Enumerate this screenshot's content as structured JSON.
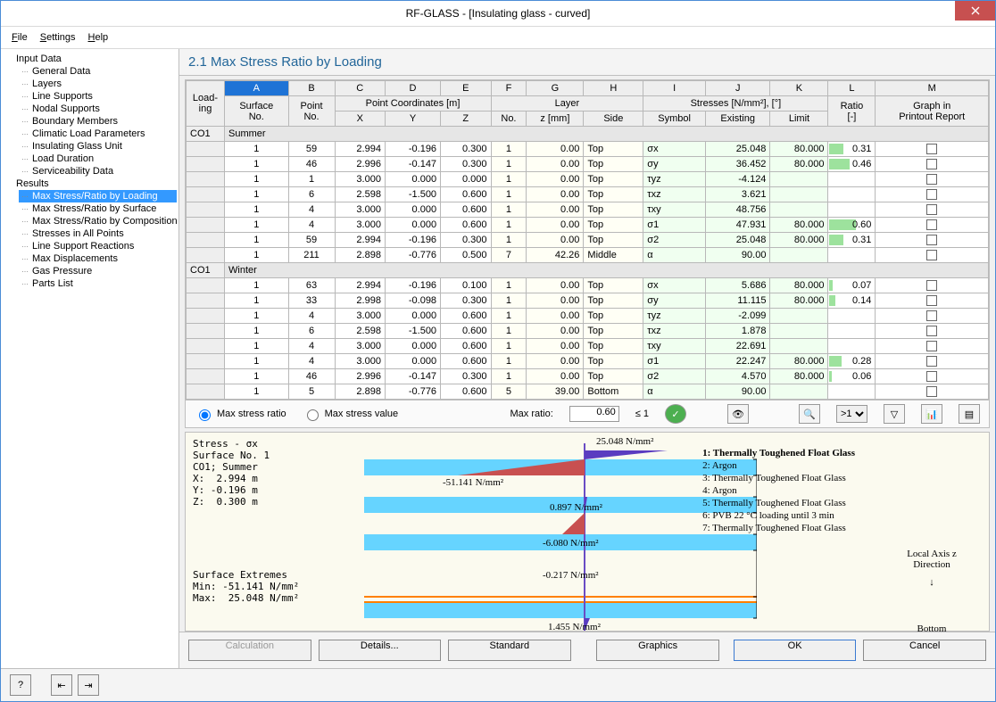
{
  "window": {
    "title": "RF-GLASS - [Insulating glass - curved]"
  },
  "menu": {
    "file": "File",
    "settings": "Settings",
    "help": "Help"
  },
  "sidebar": {
    "root1": "Input Data",
    "root1_items": [
      "General Data",
      "Layers",
      "Line Supports",
      "Nodal Supports",
      "Boundary Members",
      "Climatic Load Parameters",
      "Insulating Glass Unit",
      "Load Duration",
      "Serviceability Data"
    ],
    "root2": "Results",
    "root2_items": [
      "Max Stress/Ratio by Loading",
      "Max Stress/Ratio by Surface",
      "Max Stress/Ratio by Composition",
      "Stresses in All Points",
      "Line Support Reactions",
      "Max Displacements",
      "Gas Pressure",
      "Parts List"
    ],
    "selected": "Max Stress/Ratio by Loading"
  },
  "panel_title": "2.1 Max Stress Ratio by Loading",
  "cols_letters": [
    "A",
    "B",
    "C",
    "D",
    "E",
    "F",
    "G",
    "H",
    "I",
    "J",
    "K",
    "L",
    "M"
  ],
  "cols": {
    "loading": "Load-\ning",
    "surface": "Surface\nNo.",
    "point": "Point\nNo.",
    "coords": "Point Coordinates [m]",
    "x": "X",
    "y": "Y",
    "z": "Z",
    "layer": "Layer",
    "layer_no": "No.",
    "layer_z": "z [mm]",
    "side": "Side",
    "stresses": "Stresses [N/mm²], [°]",
    "symbol": "Symbol",
    "existing": "Existing",
    "limit": "Limit",
    "ratio": "Ratio\n[-]",
    "graph": "Graph in\nPrintout Report"
  },
  "groups": [
    {
      "loading": "CO1",
      "name": "Summer",
      "rows": [
        {
          "surf": 1,
          "pt": 59,
          "x": "2.994",
          "y": "-0.196",
          "z": "0.300",
          "ln": 1,
          "lz": "0.00",
          "side": "Top",
          "sym": "σx",
          "ex": "25.048",
          "lim": "80.000",
          "ratio": "0.31",
          "bar": 16
        },
        {
          "surf": 1,
          "pt": 46,
          "x": "2.996",
          "y": "-0.147",
          "z": "0.300",
          "ln": 1,
          "lz": "0.00",
          "side": "Top",
          "sym": "σy",
          "ex": "36.452",
          "lim": "80.000",
          "ratio": "0.46",
          "bar": 23
        },
        {
          "surf": 1,
          "pt": 1,
          "x": "3.000",
          "y": "0.000",
          "z": "0.000",
          "ln": 1,
          "lz": "0.00",
          "side": "Top",
          "sym": "τyz",
          "ex": "-4.124",
          "lim": "",
          "ratio": "",
          "bar": 0
        },
        {
          "surf": 1,
          "pt": 6,
          "x": "2.598",
          "y": "-1.500",
          "z": "0.600",
          "ln": 1,
          "lz": "0.00",
          "side": "Top",
          "sym": "τxz",
          "ex": "3.621",
          "lim": "",
          "ratio": "",
          "bar": 0
        },
        {
          "surf": 1,
          "pt": 4,
          "x": "3.000",
          "y": "0.000",
          "z": "0.600",
          "ln": 1,
          "lz": "0.00",
          "side": "Top",
          "sym": "τxy",
          "ex": "48.756",
          "lim": "",
          "ratio": "",
          "bar": 0
        },
        {
          "surf": 1,
          "pt": 4,
          "x": "3.000",
          "y": "0.000",
          "z": "0.600",
          "ln": 1,
          "lz": "0.00",
          "side": "Top",
          "sym": "σ1",
          "ex": "47.931",
          "lim": "80.000",
          "ratio": "0.60",
          "bar": 30
        },
        {
          "surf": 1,
          "pt": 59,
          "x": "2.994",
          "y": "-0.196",
          "z": "0.300",
          "ln": 1,
          "lz": "0.00",
          "side": "Top",
          "sym": "σ2",
          "ex": "25.048",
          "lim": "80.000",
          "ratio": "0.31",
          "bar": 16
        },
        {
          "surf": 1,
          "pt": 211,
          "x": "2.898",
          "y": "-0.776",
          "z": "0.500",
          "ln": 7,
          "lz": "42.26",
          "side": "Middle",
          "sym": "α",
          "ex": "90.00",
          "lim": "",
          "ratio": "",
          "bar": 0
        }
      ]
    },
    {
      "loading": "CO1",
      "name": "Winter",
      "rows": [
        {
          "surf": 1,
          "pt": 63,
          "x": "2.994",
          "y": "-0.196",
          "z": "0.100",
          "ln": 1,
          "lz": "0.00",
          "side": "Top",
          "sym": "σx",
          "ex": "5.686",
          "lim": "80.000",
          "ratio": "0.07",
          "bar": 4
        },
        {
          "surf": 1,
          "pt": 33,
          "x": "2.998",
          "y": "-0.098",
          "z": "0.300",
          "ln": 1,
          "lz": "0.00",
          "side": "Top",
          "sym": "σy",
          "ex": "11.115",
          "lim": "80.000",
          "ratio": "0.14",
          "bar": 7
        },
        {
          "surf": 1,
          "pt": 4,
          "x": "3.000",
          "y": "0.000",
          "z": "0.600",
          "ln": 1,
          "lz": "0.00",
          "side": "Top",
          "sym": "τyz",
          "ex": "-2.099",
          "lim": "",
          "ratio": "",
          "bar": 0
        },
        {
          "surf": 1,
          "pt": 6,
          "x": "2.598",
          "y": "-1.500",
          "z": "0.600",
          "ln": 1,
          "lz": "0.00",
          "side": "Top",
          "sym": "τxz",
          "ex": "1.878",
          "lim": "",
          "ratio": "",
          "bar": 0
        },
        {
          "surf": 1,
          "pt": 4,
          "x": "3.000",
          "y": "0.000",
          "z": "0.600",
          "ln": 1,
          "lz": "0.00",
          "side": "Top",
          "sym": "τxy",
          "ex": "22.691",
          "lim": "",
          "ratio": "",
          "bar": 0
        },
        {
          "surf": 1,
          "pt": 4,
          "x": "3.000",
          "y": "0.000",
          "z": "0.600",
          "ln": 1,
          "lz": "0.00",
          "side": "Top",
          "sym": "σ1",
          "ex": "22.247",
          "lim": "80.000",
          "ratio": "0.28",
          "bar": 14
        },
        {
          "surf": 1,
          "pt": 46,
          "x": "2.996",
          "y": "-0.147",
          "z": "0.300",
          "ln": 1,
          "lz": "0.00",
          "side": "Top",
          "sym": "σ2",
          "ex": "4.570",
          "lim": "80.000",
          "ratio": "0.06",
          "bar": 3
        },
        {
          "surf": 1,
          "pt": 5,
          "x": "2.898",
          "y": "-0.776",
          "z": "0.600",
          "ln": 5,
          "lz": "39.00",
          "side": "Bottom",
          "sym": "α",
          "ex": "90.00",
          "lim": "",
          "ratio": "",
          "bar": 0
        }
      ]
    }
  ],
  "toolbar": {
    "opt1": "Max stress ratio",
    "opt2": "Max stress value",
    "maxratio_label": "Max ratio:",
    "maxratio_val": "0.60",
    "le1": "≤ 1",
    "filter": ">1"
  },
  "diagram": {
    "info": "Stress - σx\nSurface No. 1\nCO1; Summer\nX:  2.994 m\nY: -0.196 m\nZ:  0.300 m",
    "extremes": "Surface Extremes\nMin: -51.141 N/mm²\nMax:  25.048 N/mm²",
    "labels": {
      "top": "25.048 N/mm²",
      "l1": "-51.141 N/mm²",
      "l2": "0.897 N/mm²",
      "l3": "-6.080 N/mm²",
      "l4": "-0.217 N/mm²",
      "bottom": "1.455 N/mm²"
    },
    "legend": [
      "1: Thermally Toughened Float Glass",
      "2: Argon",
      "3: Thermally Toughened Float Glass",
      "4: Argon",
      "5: Thermally Toughened Float Glass",
      "6: PVB 22 °C loading until 3 min",
      "7: Thermally Toughened Float Glass"
    ],
    "axis": "Local Axis z\nDirection",
    "bottom": "Bottom"
  },
  "buttons": {
    "calc": "Calculation",
    "details": "Details...",
    "standard": "Standard",
    "graphics": "Graphics",
    "ok": "OK",
    "cancel": "Cancel"
  }
}
